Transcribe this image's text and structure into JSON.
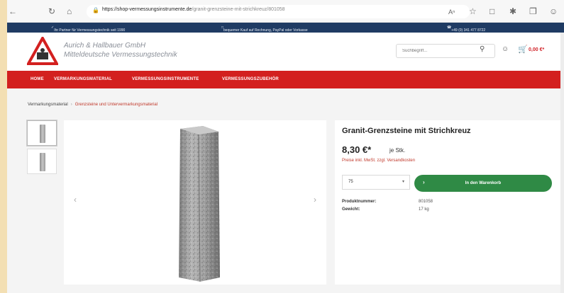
{
  "browser": {
    "url_host": "https://shop-vermessungsinstrumente.de",
    "url_path": "/granit-grenzsteine-mit-strichkreuz/801058",
    "icons": [
      "back-icon",
      "reload-icon",
      "home-icon",
      "lock-icon",
      "read-aloud-icon",
      "favorites-icon",
      "collections-icon",
      "extensions-icon",
      "profile-icon"
    ]
  },
  "topstrip": {
    "left": "Ihr Partner für Vermessungstechnik seit 1990",
    "center": "bequemer Kauf auf Rechnung, PayPal oder Vorkasse",
    "right": "+49 (0) 341 477 8722"
  },
  "header": {
    "company_line1": "Aurich & Hallbauer GmbH",
    "company_line2": "Mitteldeutsche Vermessungstechnik",
    "search_placeholder": "Suchbegriff...",
    "cart_total": "0,00 €*"
  },
  "nav": {
    "items": [
      "HOME",
      "VERMARKUNGSMATERIAL",
      "VERMESSUNGSINSTRUMENTE",
      "VERMESSUNGSZUBEHÖR"
    ]
  },
  "breadcrumb": {
    "items": [
      "Vermarkungsmaterial",
      "Grenzsteine und Untervermarkungsmaterial"
    ]
  },
  "product": {
    "title": "Granit-Grenzsteine mit Strichkreuz",
    "price": "8,30 €*",
    "unit": "je Stk.",
    "tax_note": "Preise inkl. MwSt. zzgl. Versandkosten",
    "quantity": "75",
    "add_to_cart": "In den Warenkorb",
    "specs": [
      {
        "label": "Produktnummer:",
        "value": "801058"
      },
      {
        "label": "Gewicht:",
        "value": "17 kg"
      }
    ]
  },
  "colors": {
    "nav_red": "#d3201f",
    "top_blue": "#1f3b63",
    "cart_green": "#2f8a45"
  }
}
